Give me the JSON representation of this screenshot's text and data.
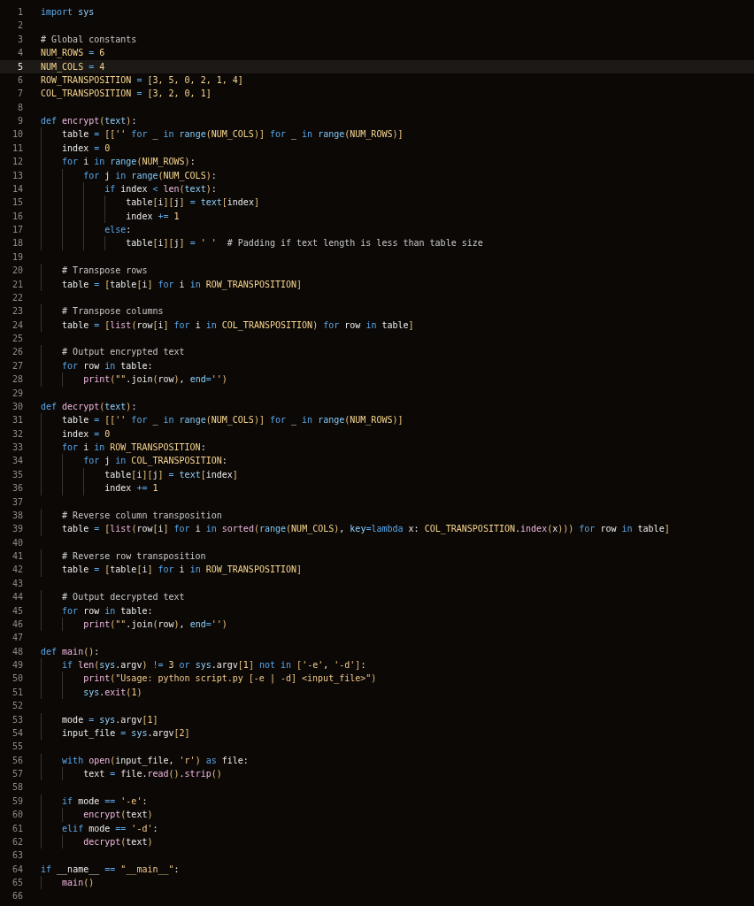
{
  "editor": {
    "lines": [
      {
        "number": "1",
        "current": false,
        "tokens": [
          {
            "kind": "kw",
            "text": "import"
          },
          {
            "kind": "pa",
            "text": " sys"
          }
        ]
      },
      {
        "number": "2",
        "current": false
      },
      {
        "number": "3",
        "current": false,
        "tokens": [
          {
            "kind": "cm",
            "text": "# Global constants"
          }
        ]
      },
      {
        "number": "4",
        "current": false,
        "tokens": [
          {
            "kind": "co",
            "text": "NUM_ROWS"
          },
          {
            "kind": "op",
            "text": " ="
          },
          {
            "kind": "nu",
            "text": " 6"
          }
        ]
      },
      {
        "number": "5",
        "current": true,
        "tokens": [
          {
            "kind": "co",
            "text": "NUM_COLS"
          },
          {
            "kind": "op",
            "text": " ="
          },
          {
            "kind": "nu",
            "text": " 4"
          }
        ]
      },
      {
        "number": "6",
        "current": false,
        "tokens": [
          {
            "kind": "co",
            "text": "ROW_TRANSPOSITION"
          },
          {
            "kind": "op",
            "text": " ="
          },
          {
            "kind": "nu",
            "text": " [3, 5, 0, 2, 1, 4]"
          }
        ]
      },
      {
        "number": "7",
        "current": false,
        "tokens": [
          {
            "kind": "co",
            "text": "COL_TRANSPOSITION"
          },
          {
            "kind": "op",
            "text": " ="
          },
          {
            "kind": "nu",
            "text": " [3, 2, 0, 1]"
          }
        ]
      },
      {
        "number": "8",
        "current": false
      },
      {
        "number": "9",
        "current": false,
        "tokens": [
          {
            "kind": "kw",
            "text": "def"
          },
          {
            "kind": "fn",
            "text": " encrypt"
          },
          {
            "kind": "br",
            "text": "("
          },
          {
            "kind": "pa",
            "text": "text"
          },
          {
            "kind": "br",
            "text": ")"
          },
          {
            "kind": "pl",
            "text": ":"
          }
        ]
      },
      {
        "number": "10",
        "current": false,
        "tokens": [
          {
            "kind": "pl",
            "text": "    table"
          },
          {
            "kind": "op",
            "text": " ="
          },
          {
            "kind": "br",
            "text": " [["
          },
          {
            "kind": "st",
            "text": "''"
          },
          {
            "kind": "kw",
            "text": " for"
          },
          {
            "kind": "pl",
            "text": " _"
          },
          {
            "kind": "kw",
            "text": " in"
          },
          {
            "kind": "bi",
            "text": " range"
          },
          {
            "kind": "br",
            "text": "("
          },
          {
            "kind": "co",
            "text": "NUM_COLS"
          },
          {
            "kind": "br",
            "text": ")]"
          },
          {
            "kind": "kw",
            "text": " for"
          },
          {
            "kind": "pl",
            "text": " _"
          },
          {
            "kind": "kw",
            "text": " in"
          },
          {
            "kind": "bi",
            "text": " range"
          },
          {
            "kind": "br",
            "text": "("
          },
          {
            "kind": "co",
            "text": "NUM_ROWS"
          },
          {
            "kind": "br",
            "text": ")]"
          }
        ]
      },
      {
        "number": "11",
        "current": false,
        "tokens": [
          {
            "kind": "pl",
            "text": "    index"
          },
          {
            "kind": "op",
            "text": " ="
          },
          {
            "kind": "nu",
            "text": " 0"
          }
        ]
      },
      {
        "number": "12",
        "current": false,
        "tokens": [
          {
            "kind": "kw",
            "text": "    for"
          },
          {
            "kind": "pl",
            "text": " i"
          },
          {
            "kind": "kw",
            "text": " in"
          },
          {
            "kind": "bi",
            "text": " range"
          },
          {
            "kind": "br",
            "text": "("
          },
          {
            "kind": "co",
            "text": "NUM_ROWS"
          },
          {
            "kind": "br",
            "text": ")"
          },
          {
            "kind": "pl",
            "text": ":"
          }
        ]
      },
      {
        "number": "13",
        "current": false,
        "tokens": [
          {
            "kind": "kw",
            "text": "        for"
          },
          {
            "kind": "pl",
            "text": " j"
          },
          {
            "kind": "kw",
            "text": " in"
          },
          {
            "kind": "bi",
            "text": " range"
          },
          {
            "kind": "br",
            "text": "("
          },
          {
            "kind": "co",
            "text": "NUM_COLS"
          },
          {
            "kind": "br",
            "text": ")"
          },
          {
            "kind": "pl",
            "text": ":"
          }
        ]
      },
      {
        "number": "14",
        "current": false,
        "tokens": [
          {
            "kind": "kw",
            "text": "            if"
          },
          {
            "kind": "pl",
            "text": " index"
          },
          {
            "kind": "op",
            "text": " <"
          },
          {
            "kind": "fn",
            "text": " len"
          },
          {
            "kind": "br",
            "text": "("
          },
          {
            "kind": "pa",
            "text": "text"
          },
          {
            "kind": "br",
            "text": ")"
          },
          {
            "kind": "pl",
            "text": ":"
          }
        ]
      },
      {
        "number": "15",
        "current": false,
        "tokens": [
          {
            "kind": "pl",
            "text": "                table"
          },
          {
            "kind": "br",
            "text": "["
          },
          {
            "kind": "pl",
            "text": "i"
          },
          {
            "kind": "br",
            "text": "]["
          },
          {
            "kind": "pl",
            "text": "j"
          },
          {
            "kind": "br",
            "text": "]"
          },
          {
            "kind": "op",
            "text": " ="
          },
          {
            "kind": "pa",
            "text": " text"
          },
          {
            "kind": "br",
            "text": "["
          },
          {
            "kind": "pl",
            "text": "index"
          },
          {
            "kind": "br",
            "text": "]"
          }
        ]
      },
      {
        "number": "16",
        "current": false,
        "tokens": [
          {
            "kind": "pl",
            "text": "                index"
          },
          {
            "kind": "op",
            "text": " +="
          },
          {
            "kind": "nu",
            "text": " 1"
          }
        ]
      },
      {
        "number": "17",
        "current": false,
        "tokens": [
          {
            "kind": "kw",
            "text": "            else"
          },
          {
            "kind": "pl",
            "text": ":"
          }
        ]
      },
      {
        "number": "18",
        "current": false,
        "tokens": [
          {
            "kind": "pl",
            "text": "                table"
          },
          {
            "kind": "br",
            "text": "["
          },
          {
            "kind": "pl",
            "text": "i"
          },
          {
            "kind": "br",
            "text": "]["
          },
          {
            "kind": "pl",
            "text": "j"
          },
          {
            "kind": "br",
            "text": "]"
          },
          {
            "kind": "op",
            "text": " ="
          },
          {
            "kind": "st",
            "text": " ' '"
          },
          {
            "kind": "cm",
            "text": "  # Padding if text length is less than table size"
          }
        ]
      },
      {
        "number": "19",
        "current": false
      },
      {
        "number": "20",
        "current": false,
        "tokens": [
          {
            "kind": "cm",
            "text": "    # Transpose rows"
          }
        ]
      },
      {
        "number": "21",
        "current": false,
        "tokens": [
          {
            "kind": "pl",
            "text": "    table"
          },
          {
            "kind": "op",
            "text": " ="
          },
          {
            "kind": "br",
            "text": " ["
          },
          {
            "kind": "pl",
            "text": "table"
          },
          {
            "kind": "br",
            "text": "["
          },
          {
            "kind": "pl",
            "text": "i"
          },
          {
            "kind": "br",
            "text": "]"
          },
          {
            "kind": "kw",
            "text": " for"
          },
          {
            "kind": "pl",
            "text": " i"
          },
          {
            "kind": "kw",
            "text": " in"
          },
          {
            "kind": "co",
            "text": " ROW_TRANSPOSITION"
          },
          {
            "kind": "br",
            "text": "]"
          }
        ]
      },
      {
        "number": "22",
        "current": false
      },
      {
        "number": "23",
        "current": false,
        "tokens": [
          {
            "kind": "cm",
            "text": "    # Transpose columns"
          }
        ]
      },
      {
        "number": "24",
        "current": false,
        "tokens": [
          {
            "kind": "pl",
            "text": "    table"
          },
          {
            "kind": "op",
            "text": " ="
          },
          {
            "kind": "br",
            "text": " ["
          },
          {
            "kind": "fn",
            "text": "list"
          },
          {
            "kind": "br",
            "text": "("
          },
          {
            "kind": "pl",
            "text": "row"
          },
          {
            "kind": "br",
            "text": "["
          },
          {
            "kind": "pl",
            "text": "i"
          },
          {
            "kind": "br",
            "text": "]"
          },
          {
            "kind": "kw",
            "text": " for"
          },
          {
            "kind": "pl",
            "text": " i"
          },
          {
            "kind": "kw",
            "text": " in"
          },
          {
            "kind": "co",
            "text": " COL_TRANSPOSITION"
          },
          {
            "kind": "br",
            "text": ")"
          },
          {
            "kind": "kw",
            "text": " for"
          },
          {
            "kind": "pl",
            "text": " row"
          },
          {
            "kind": "kw",
            "text": " in"
          },
          {
            "kind": "pl",
            "text": " table"
          },
          {
            "kind": "br",
            "text": "]"
          }
        ]
      },
      {
        "number": "25",
        "current": false
      },
      {
        "number": "26",
        "current": false,
        "tokens": [
          {
            "kind": "cm",
            "text": "    # Output encrypted text"
          }
        ]
      },
      {
        "number": "27",
        "current": false,
        "tokens": [
          {
            "kind": "kw",
            "text": "    for"
          },
          {
            "kind": "pl",
            "text": " row"
          },
          {
            "kind": "kw",
            "text": " in"
          },
          {
            "kind": "pl",
            "text": " table:"
          }
        ]
      },
      {
        "number": "28",
        "current": false,
        "tokens": [
          {
            "kind": "fn",
            "text": "        print"
          },
          {
            "kind": "br",
            "text": "("
          },
          {
            "kind": "st",
            "text": "\"\""
          },
          {
            "kind": "pl",
            "text": ".join"
          },
          {
            "kind": "br",
            "text": "("
          },
          {
            "kind": "pl",
            "text": "row"
          },
          {
            "kind": "br",
            "text": ")"
          },
          {
            "kind": "pl",
            "text": ","
          },
          {
            "kind": "pa",
            "text": " end"
          },
          {
            "kind": "op",
            "text": "="
          },
          {
            "kind": "st",
            "text": "''"
          },
          {
            "kind": "br",
            "text": ")"
          }
        ]
      },
      {
        "number": "29",
        "current": false
      },
      {
        "number": "30",
        "current": false,
        "tokens": [
          {
            "kind": "kw",
            "text": "def"
          },
          {
            "kind": "fn",
            "text": " decrypt"
          },
          {
            "kind": "br",
            "text": "("
          },
          {
            "kind": "pa",
            "text": "text"
          },
          {
            "kind": "br",
            "text": ")"
          },
          {
            "kind": "pl",
            "text": ":"
          }
        ]
      },
      {
        "number": "31",
        "current": false,
        "tokens": [
          {
            "kind": "pl",
            "text": "    table"
          },
          {
            "kind": "op",
            "text": " ="
          },
          {
            "kind": "br",
            "text": " [["
          },
          {
            "kind": "st",
            "text": "''"
          },
          {
            "kind": "kw",
            "text": " for"
          },
          {
            "kind": "pl",
            "text": " _"
          },
          {
            "kind": "kw",
            "text": " in"
          },
          {
            "kind": "bi",
            "text": " range"
          },
          {
            "kind": "br",
            "text": "("
          },
          {
            "kind": "co",
            "text": "NUM_COLS"
          },
          {
            "kind": "br",
            "text": ")]"
          },
          {
            "kind": "kw",
            "text": " for"
          },
          {
            "kind": "pl",
            "text": " _"
          },
          {
            "kind": "kw",
            "text": " in"
          },
          {
            "kind": "bi",
            "text": " range"
          },
          {
            "kind": "br",
            "text": "("
          },
          {
            "kind": "co",
            "text": "NUM_ROWS"
          },
          {
            "kind": "br",
            "text": ")]"
          }
        ]
      },
      {
        "number": "32",
        "current": false,
        "tokens": [
          {
            "kind": "pl",
            "text": "    index"
          },
          {
            "kind": "op",
            "text": " ="
          },
          {
            "kind": "nu",
            "text": " 0"
          }
        ]
      },
      {
        "number": "33",
        "current": false,
        "tokens": [
          {
            "kind": "kw",
            "text": "    for"
          },
          {
            "kind": "pl",
            "text": " i"
          },
          {
            "kind": "kw",
            "text": " in"
          },
          {
            "kind": "co",
            "text": " ROW_TRANSPOSITION"
          },
          {
            "kind": "pl",
            "text": ":"
          }
        ]
      },
      {
        "number": "34",
        "current": false,
        "tokens": [
          {
            "kind": "kw",
            "text": "        for"
          },
          {
            "kind": "pl",
            "text": " j"
          },
          {
            "kind": "kw",
            "text": " in"
          },
          {
            "kind": "co",
            "text": " COL_TRANSPOSITION"
          },
          {
            "kind": "pl",
            "text": ":"
          }
        ]
      },
      {
        "number": "35",
        "current": false,
        "tokens": [
          {
            "kind": "pl",
            "text": "            table"
          },
          {
            "kind": "br",
            "text": "["
          },
          {
            "kind": "pl",
            "text": "i"
          },
          {
            "kind": "br",
            "text": "]["
          },
          {
            "kind": "pl",
            "text": "j"
          },
          {
            "kind": "br",
            "text": "]"
          },
          {
            "kind": "op",
            "text": " ="
          },
          {
            "kind": "pa",
            "text": " text"
          },
          {
            "kind": "br",
            "text": "["
          },
          {
            "kind": "pl",
            "text": "index"
          },
          {
            "kind": "br",
            "text": "]"
          }
        ]
      },
      {
        "number": "36",
        "current": false,
        "tokens": [
          {
            "kind": "pl",
            "text": "            index"
          },
          {
            "kind": "op",
            "text": " +="
          },
          {
            "kind": "nu",
            "text": " 1"
          }
        ]
      },
      {
        "number": "37",
        "current": false
      },
      {
        "number": "38",
        "current": false,
        "tokens": [
          {
            "kind": "cm",
            "text": "    # Reverse column transposition"
          }
        ]
      },
      {
        "number": "39",
        "current": false,
        "tokens": [
          {
            "kind": "pl",
            "text": "    table"
          },
          {
            "kind": "op",
            "text": " ="
          },
          {
            "kind": "br",
            "text": " ["
          },
          {
            "kind": "fn",
            "text": "list"
          },
          {
            "kind": "br",
            "text": "("
          },
          {
            "kind": "pl",
            "text": "row"
          },
          {
            "kind": "br",
            "text": "["
          },
          {
            "kind": "pl",
            "text": "i"
          },
          {
            "kind": "br",
            "text": "]"
          },
          {
            "kind": "kw",
            "text": " for"
          },
          {
            "kind": "pl",
            "text": " i"
          },
          {
            "kind": "kw",
            "text": " in"
          },
          {
            "kind": "fn",
            "text": " sorted"
          },
          {
            "kind": "br",
            "text": "("
          },
          {
            "kind": "bi",
            "text": "range"
          },
          {
            "kind": "br",
            "text": "("
          },
          {
            "kind": "co",
            "text": "NUM_COLS"
          },
          {
            "kind": "br",
            "text": ")"
          },
          {
            "kind": "pl",
            "text": ","
          },
          {
            "kind": "pa",
            "text": " key"
          },
          {
            "kind": "op",
            "text": "="
          },
          {
            "kind": "kw",
            "text": "lambda"
          },
          {
            "kind": "pl",
            "text": " x:"
          },
          {
            "kind": "co",
            "text": " COL_TRANSPOSITION"
          },
          {
            "kind": "pl",
            "text": "."
          },
          {
            "kind": "fn",
            "text": "index"
          },
          {
            "kind": "br",
            "text": "("
          },
          {
            "kind": "pl",
            "text": "x"
          },
          {
            "kind": "br",
            "text": ")))"
          },
          {
            "kind": "kw",
            "text": " for"
          },
          {
            "kind": "pl",
            "text": " row"
          },
          {
            "kind": "kw",
            "text": " in"
          },
          {
            "kind": "pl",
            "text": " table"
          },
          {
            "kind": "br",
            "text": "]"
          }
        ]
      },
      {
        "number": "40",
        "current": false
      },
      {
        "number": "41",
        "current": false,
        "tokens": [
          {
            "kind": "cm",
            "text": "    # Reverse row transposition"
          }
        ]
      },
      {
        "number": "42",
        "current": false,
        "tokens": [
          {
            "kind": "pl",
            "text": "    table"
          },
          {
            "kind": "op",
            "text": " ="
          },
          {
            "kind": "br",
            "text": " ["
          },
          {
            "kind": "pl",
            "text": "table"
          },
          {
            "kind": "br",
            "text": "["
          },
          {
            "kind": "pl",
            "text": "i"
          },
          {
            "kind": "br",
            "text": "]"
          },
          {
            "kind": "kw",
            "text": " for"
          },
          {
            "kind": "pl",
            "text": " i"
          },
          {
            "kind": "kw",
            "text": " in"
          },
          {
            "kind": "co",
            "text": " ROW_TRANSPOSITION"
          },
          {
            "kind": "br",
            "text": "]"
          }
        ]
      },
      {
        "number": "43",
        "current": false
      },
      {
        "number": "44",
        "current": false,
        "tokens": [
          {
            "kind": "cm",
            "text": "    # Output decrypted text"
          }
        ]
      },
      {
        "number": "45",
        "current": false,
        "tokens": [
          {
            "kind": "kw",
            "text": "    for"
          },
          {
            "kind": "pl",
            "text": " row"
          },
          {
            "kind": "kw",
            "text": " in"
          },
          {
            "kind": "pl",
            "text": " table:"
          }
        ]
      },
      {
        "number": "46",
        "current": false,
        "tokens": [
          {
            "kind": "fn",
            "text": "        print"
          },
          {
            "kind": "br",
            "text": "("
          },
          {
            "kind": "st",
            "text": "\"\""
          },
          {
            "kind": "pl",
            "text": ".join"
          },
          {
            "kind": "br",
            "text": "("
          },
          {
            "kind": "pl",
            "text": "row"
          },
          {
            "kind": "br",
            "text": ")"
          },
          {
            "kind": "pl",
            "text": ","
          },
          {
            "kind": "pa",
            "text": " end"
          },
          {
            "kind": "op",
            "text": "="
          },
          {
            "kind": "st",
            "text": "''"
          },
          {
            "kind": "br",
            "text": ")"
          }
        ]
      },
      {
        "number": "47",
        "current": false
      },
      {
        "number": "48",
        "current": false,
        "tokens": [
          {
            "kind": "kw",
            "text": "def"
          },
          {
            "kind": "fn",
            "text": " main"
          },
          {
            "kind": "br",
            "text": "()"
          },
          {
            "kind": "pl",
            "text": ":"
          }
        ]
      },
      {
        "number": "49",
        "current": false,
        "tokens": [
          {
            "kind": "kw",
            "text": "    if"
          },
          {
            "kind": "fn",
            "text": " len"
          },
          {
            "kind": "br",
            "text": "("
          },
          {
            "kind": "pa",
            "text": "sys"
          },
          {
            "kind": "pl",
            "text": ".argv"
          },
          {
            "kind": "br",
            "text": ")"
          },
          {
            "kind": "op",
            "text": " !="
          },
          {
            "kind": "nu",
            "text": " 3"
          },
          {
            "kind": "kw",
            "text": " or"
          },
          {
            "kind": "pa",
            "text": " sys"
          },
          {
            "kind": "pl",
            "text": ".argv"
          },
          {
            "kind": "br",
            "text": "["
          },
          {
            "kind": "nu",
            "text": "1"
          },
          {
            "kind": "br",
            "text": "]"
          },
          {
            "kind": "kw",
            "text": " not in"
          },
          {
            "kind": "br",
            "text": " ["
          },
          {
            "kind": "st",
            "text": "'-e'"
          },
          {
            "kind": "pl",
            "text": ","
          },
          {
            "kind": "st",
            "text": " '-d'"
          },
          {
            "kind": "br",
            "text": "]"
          },
          {
            "kind": "pl",
            "text": ":"
          }
        ]
      },
      {
        "number": "50",
        "current": false,
        "tokens": [
          {
            "kind": "fn",
            "text": "        print"
          },
          {
            "kind": "br",
            "text": "("
          },
          {
            "kind": "st",
            "text": "\"Usage: python script.py [-e | -d] <input_file>\""
          },
          {
            "kind": "br",
            "text": ")"
          }
        ]
      },
      {
        "number": "51",
        "current": false,
        "tokens": [
          {
            "kind": "pa",
            "text": "        sys"
          },
          {
            "kind": "pl",
            "text": "."
          },
          {
            "kind": "fn",
            "text": "exit"
          },
          {
            "kind": "br",
            "text": "("
          },
          {
            "kind": "nu",
            "text": "1"
          },
          {
            "kind": "br",
            "text": ")"
          }
        ]
      },
      {
        "number": "52",
        "current": false
      },
      {
        "number": "53",
        "current": false,
        "tokens": [
          {
            "kind": "pl",
            "text": "    mode"
          },
          {
            "kind": "op",
            "text": " ="
          },
          {
            "kind": "pa",
            "text": " sys"
          },
          {
            "kind": "pl",
            "text": ".argv"
          },
          {
            "kind": "br",
            "text": "["
          },
          {
            "kind": "nu",
            "text": "1"
          },
          {
            "kind": "br",
            "text": "]"
          }
        ]
      },
      {
        "number": "54",
        "current": false,
        "tokens": [
          {
            "kind": "pl",
            "text": "    input_file"
          },
          {
            "kind": "op",
            "text": " ="
          },
          {
            "kind": "pa",
            "text": " sys"
          },
          {
            "kind": "pl",
            "text": ".argv"
          },
          {
            "kind": "br",
            "text": "["
          },
          {
            "kind": "nu",
            "text": "2"
          },
          {
            "kind": "br",
            "text": "]"
          }
        ]
      },
      {
        "number": "55",
        "current": false
      },
      {
        "number": "56",
        "current": false,
        "tokens": [
          {
            "kind": "kw",
            "text": "    with"
          },
          {
            "kind": "fn",
            "text": " open"
          },
          {
            "kind": "br",
            "text": "("
          },
          {
            "kind": "pl",
            "text": "input_file,"
          },
          {
            "kind": "st",
            "text": " 'r'"
          },
          {
            "kind": "br",
            "text": ")"
          },
          {
            "kind": "kw",
            "text": " as"
          },
          {
            "kind": "pl",
            "text": " file:"
          }
        ]
      },
      {
        "number": "57",
        "current": false,
        "tokens": [
          {
            "kind": "pl",
            "text": "        text"
          },
          {
            "kind": "op",
            "text": " ="
          },
          {
            "kind": "pl",
            "text": " file."
          },
          {
            "kind": "fn",
            "text": "read"
          },
          {
            "kind": "br",
            "text": "()"
          },
          {
            "kind": "pl",
            "text": "."
          },
          {
            "kind": "fn",
            "text": "strip"
          },
          {
            "kind": "br",
            "text": "()"
          }
        ]
      },
      {
        "number": "58",
        "current": false
      },
      {
        "number": "59",
        "current": false,
        "tokens": [
          {
            "kind": "kw",
            "text": "    if"
          },
          {
            "kind": "pl",
            "text": " mode"
          },
          {
            "kind": "op",
            "text": " =="
          },
          {
            "kind": "st",
            "text": " '-e'"
          },
          {
            "kind": "pl",
            "text": ":"
          }
        ]
      },
      {
        "number": "60",
        "current": false,
        "tokens": [
          {
            "kind": "fn",
            "text": "        encrypt"
          },
          {
            "kind": "br",
            "text": "("
          },
          {
            "kind": "pl",
            "text": "text"
          },
          {
            "kind": "br",
            "text": ")"
          }
        ]
      },
      {
        "number": "61",
        "current": false,
        "tokens": [
          {
            "kind": "kw",
            "text": "    elif"
          },
          {
            "kind": "pl",
            "text": " mode"
          },
          {
            "kind": "op",
            "text": " =="
          },
          {
            "kind": "st",
            "text": " '-d'"
          },
          {
            "kind": "pl",
            "text": ":"
          }
        ]
      },
      {
        "number": "62",
        "current": false,
        "tokens": [
          {
            "kind": "fn",
            "text": "        decrypt"
          },
          {
            "kind": "br",
            "text": "("
          },
          {
            "kind": "pl",
            "text": "text"
          },
          {
            "kind": "br",
            "text": ")"
          }
        ]
      },
      {
        "number": "63",
        "current": false
      },
      {
        "number": "64",
        "current": false,
        "tokens": [
          {
            "kind": "kw",
            "text": "if"
          },
          {
            "kind": "pl",
            "text": " __name__"
          },
          {
            "kind": "op",
            "text": " =="
          },
          {
            "kind": "st",
            "text": " \"__main__\""
          },
          {
            "kind": "pl",
            "text": ":"
          }
        ]
      },
      {
        "number": "65",
        "current": false,
        "tokens": [
          {
            "kind": "fn",
            "text": "    main"
          },
          {
            "kind": "br",
            "text": "()"
          }
        ]
      },
      {
        "number": "66",
        "current": false
      }
    ]
  }
}
